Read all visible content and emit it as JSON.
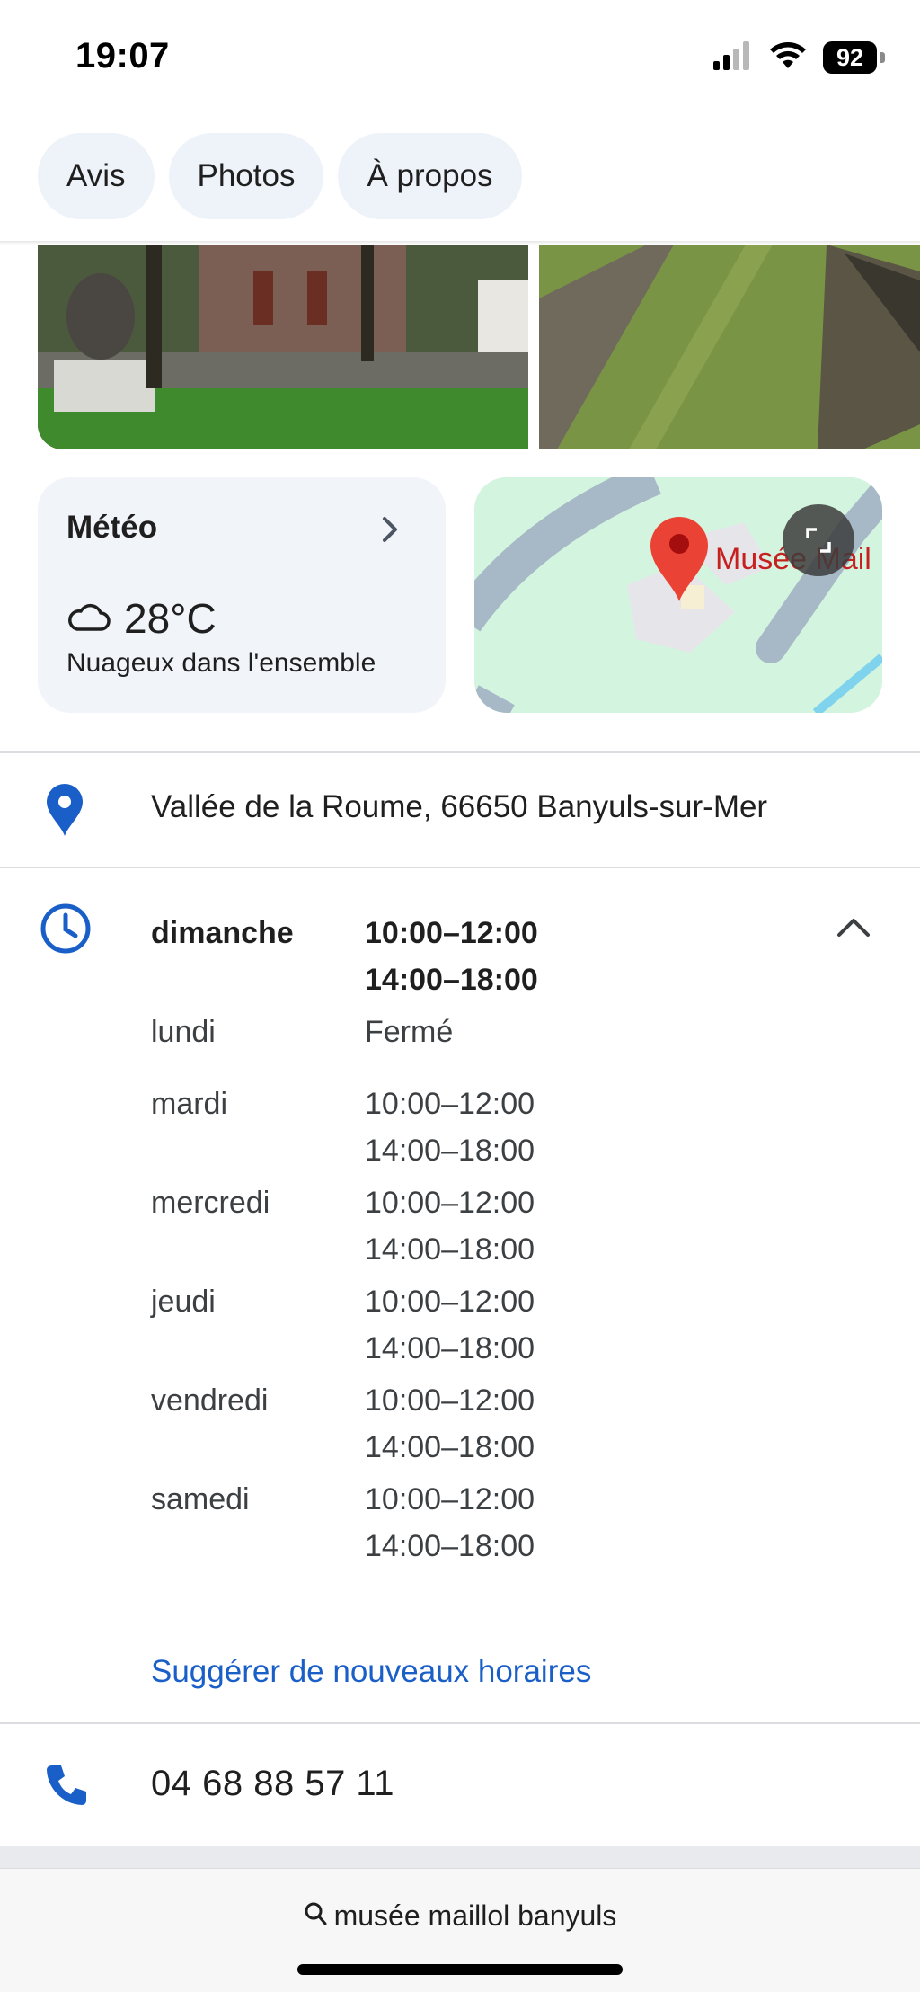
{
  "status_bar": {
    "time": "19:07",
    "battery": "92",
    "icons": [
      "cellular-signal-icon",
      "wifi-icon",
      "battery-icon"
    ]
  },
  "tabs": [
    {
      "label": "Avis"
    },
    {
      "label": "Photos"
    },
    {
      "label": "À propos"
    }
  ],
  "weather": {
    "title": "Météo",
    "temperature": "28°C",
    "description": "Nuageux dans l'ensemble",
    "icon": "cloud-icon"
  },
  "map": {
    "label": "Musée Mail",
    "pin_color": "#ea4335",
    "water_color": "#d3f5e0"
  },
  "address": {
    "text": "Vallée de la Roume, 66650 Banyuls-sur-Mer",
    "icon": "location-pin-icon"
  },
  "hours": {
    "icon": "clock-icon",
    "days": [
      {
        "day": "dimanche",
        "hours": [
          "10:00–12:00",
          "14:00–18:00"
        ],
        "today": true
      },
      {
        "day": "lundi",
        "hours": [
          "Fermé"
        ]
      },
      {
        "day": "mardi",
        "hours": [
          "10:00–12:00",
          "14:00–18:00"
        ]
      },
      {
        "day": "mercredi",
        "hours": [
          "10:00–12:00",
          "14:00–18:00"
        ]
      },
      {
        "day": "jeudi",
        "hours": [
          "10:00–12:00",
          "14:00–18:00"
        ]
      },
      {
        "day": "vendredi",
        "hours": [
          "10:00–12:00",
          "14:00–18:00"
        ]
      },
      {
        "day": "samedi",
        "hours": [
          "10:00–12:00",
          "14:00–18:00"
        ]
      }
    ],
    "suggest_link": "Suggérer de nouveaux horaires"
  },
  "phone": {
    "number": "04 68 88 57 11",
    "icon": "phone-icon"
  },
  "search": {
    "query": "musée maillol banyuls"
  },
  "colors": {
    "accent": "#1a5fc8",
    "chip_bg": "#eef2f9",
    "card_bg": "#f1f4f9"
  }
}
